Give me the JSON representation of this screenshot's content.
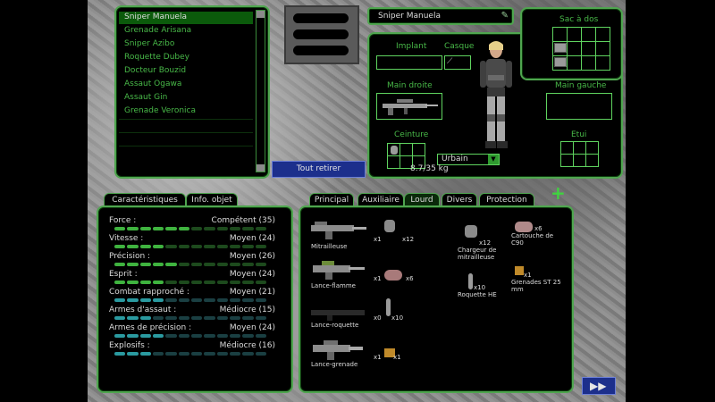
{
  "roster": [
    "Sniper Manuela",
    "Grenade Arisana",
    "Sniper Azibo",
    "Roquette Dubey",
    "Docteur Bouzid",
    "Assaut Ogawa",
    "Assaut Gin",
    "Grenade Veronica"
  ],
  "selected_index": 0,
  "strip_all_button": "Tout retirer",
  "soldier": {
    "name": "Sniper Manuela",
    "slots": {
      "implant": "Implant",
      "helmet": "Casque",
      "backpack": "Sac à dos",
      "right_hand": "Main droite",
      "left_hand": "Main gauche",
      "belt": "Ceinture",
      "holster": "Etui"
    },
    "camo": "Urbain",
    "weight": "8.7/35 kg"
  },
  "stat_tabs": [
    "Caractéristiques",
    "Info. objet"
  ],
  "stats": [
    {
      "name": "Force :",
      "rating": "Compétent (35)",
      "level": 0.35,
      "color": "green"
    },
    {
      "name": "Vitesse :",
      "rating": "Moyen (24)",
      "level": 0.24,
      "color": "green"
    },
    {
      "name": "Précision :",
      "rating": "Moyen (26)",
      "level": 0.26,
      "color": "green"
    },
    {
      "name": "Esprit :",
      "rating": "Moyen (24)",
      "level": 0.24,
      "color": "green"
    },
    {
      "name": "Combat rapproché :",
      "rating": "Moyen (21)",
      "level": 0.21,
      "color": "blue"
    },
    {
      "name": "Armes d'assaut :",
      "rating": "Médiocre (15)",
      "level": 0.15,
      "color": "blue"
    },
    {
      "name": "Armes de précision :",
      "rating": "Moyen (24)",
      "level": 0.24,
      "color": "blue"
    },
    {
      "name": "Explosifs :",
      "rating": "Médiocre (16)",
      "level": 0.16,
      "color": "blue"
    }
  ],
  "store_tabs": [
    "Principal",
    "Auxiliaire",
    "Lourd",
    "Divers",
    "Protection"
  ],
  "active_store_tab": "Lourd",
  "weapons": [
    {
      "name": "Mitrailleuse",
      "count": "x1",
      "ammo_count": "x12"
    },
    {
      "name": "Lance-flamme",
      "count": "x1",
      "ammo_count": "x6"
    },
    {
      "name": "Lance-roquette",
      "count": "x0",
      "ammo_count": "x10"
    },
    {
      "name": "Lance-grenade",
      "count": "x1",
      "ammo_count": "x1"
    }
  ],
  "ammo_items": [
    {
      "name": "Chargeur de mitrailleuse",
      "count": "x12"
    },
    {
      "name": "Roquette HE",
      "count": "x10"
    }
  ],
  "misc_items": [
    {
      "name": "Cartouche de C90",
      "count": "x6"
    },
    {
      "name": "Grenades ST 25 mm",
      "count": "x1"
    }
  ],
  "colors": {
    "panel_border": "#4fa54f",
    "text_green": "#48b848",
    "accent_blue": "#2a9aa0"
  }
}
